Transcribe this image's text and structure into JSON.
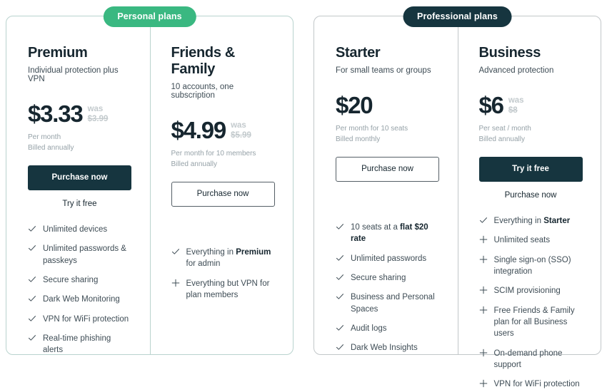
{
  "groups": [
    {
      "badge": "Personal plans",
      "accent": "#3ab881",
      "border": "#b9d3ce",
      "plans": [
        {
          "name": "Premium",
          "tagline": "Individual protection plus VPN",
          "price": "$3.33",
          "was_label": "was",
          "was_value": "$3.99",
          "billing_line1": "Per month",
          "billing_line2": "Billed annually",
          "primary_cta": "Purchase now",
          "primary_style": "filled",
          "secondary_cta": "Try it free",
          "features": [
            {
              "icon": "check-icon",
              "text": "Unlimited devices"
            },
            {
              "icon": "check-icon",
              "text": "Unlimited passwords & passkeys"
            },
            {
              "icon": "check-icon",
              "text": "Secure sharing"
            },
            {
              "icon": "check-icon",
              "text": "Dark Web Monitoring"
            },
            {
              "icon": "check-icon",
              "text": "VPN for WiFi protection"
            },
            {
              "icon": "check-icon",
              "text": "Real-time phishing alerts"
            }
          ]
        },
        {
          "name": "Friends & Family",
          "tagline": "10 accounts, one subscription",
          "price": "$4.99",
          "was_label": "was",
          "was_value": "$5.99",
          "billing_line1": "Per month for 10 members",
          "billing_line2": "Billed annually",
          "primary_cta": "Purchase now",
          "primary_style": "outline",
          "secondary_cta": "",
          "features": [
            {
              "icon": "check-icon",
              "text_html": "Everything in <b>Premium</b> for admin"
            },
            {
              "icon": "plus-icon",
              "text": "Everything but VPN for plan members"
            }
          ]
        }
      ]
    },
    {
      "badge": "Professional plans",
      "accent": "#16353f",
      "border": "#c2c7c9",
      "plans": [
        {
          "name": "Starter",
          "tagline": "For small teams or groups",
          "price": "$20",
          "was_label": "",
          "was_value": "",
          "billing_line1": "Per month for 10 seats",
          "billing_line2": "Billed monthly",
          "primary_cta": "Purchase now",
          "primary_style": "outline",
          "secondary_cta": "",
          "features": [
            {
              "icon": "check-icon",
              "text_html": "10 seats at a <b>flat $20 rate</b>"
            },
            {
              "icon": "check-icon",
              "text": "Unlimited passwords"
            },
            {
              "icon": "check-icon",
              "text": "Secure sharing"
            },
            {
              "icon": "check-icon",
              "text": "Business and Personal Spaces"
            },
            {
              "icon": "check-icon",
              "text": "Audit logs"
            },
            {
              "icon": "check-icon",
              "text": "Dark Web Insights"
            }
          ]
        },
        {
          "name": "Business",
          "tagline": "Advanced protection",
          "price": "$6",
          "was_label": "was",
          "was_value": "$8",
          "billing_line1": "Per seat / month",
          "billing_line2": "Billed annually",
          "primary_cta": "Try it free",
          "primary_style": "filled",
          "secondary_cta": "Purchase now",
          "features": [
            {
              "icon": "check-icon",
              "text_html": "Everything in <b>Starter</b>"
            },
            {
              "icon": "plus-icon",
              "text": "Unlimited seats"
            },
            {
              "icon": "plus-icon",
              "text": "Single sign-on (SSO) integration"
            },
            {
              "icon": "plus-icon",
              "text": "SCIM provisioning"
            },
            {
              "icon": "plus-icon",
              "text": "Free Friends & Family plan for all Business users"
            },
            {
              "icon": "plus-icon",
              "text": "On-demand phone support"
            },
            {
              "icon": "plus-icon",
              "text": "VPN for WiFi protection"
            }
          ]
        }
      ]
    }
  ]
}
